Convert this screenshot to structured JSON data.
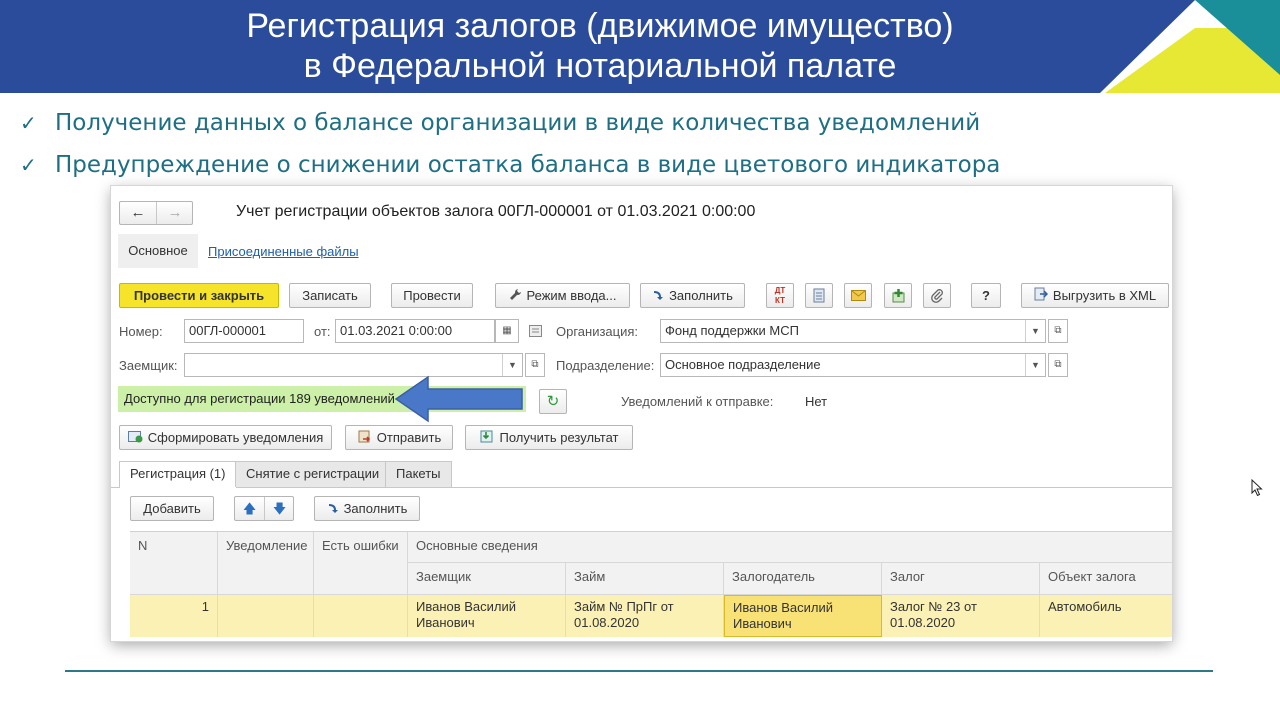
{
  "slide": {
    "title_line1": "Регистрация залогов (движимое имущество)",
    "title_line2": "в Федеральной нотариальной палате",
    "bullets": [
      "Получение данных о балансе организации в виде количества уведомлений",
      "Предупреждение о снижении остатка баланса в виде цветового индикатора"
    ]
  },
  "colors": {
    "header_bg": "#2b4c9b",
    "accent_yellow": "#f5e42a",
    "teal": "#1e6e84",
    "indicator_green": "#cdf0a8",
    "arrow_blue": "#4a78c8"
  },
  "window": {
    "title": "Учет регистрации объектов залога 00ГЛ-000001 от 01.03.2021 0:00:00",
    "nav_tabs": [
      "Основное",
      "Присоединенные файлы"
    ],
    "toolbar": {
      "post_close": "Провести и закрыть",
      "write": "Записать",
      "post": "Провести",
      "input_mode": "Режим ввода...",
      "fill": "Заполнить",
      "help": "?",
      "export_xml": "Выгрузить в XML",
      "icons": [
        "dt-kt-icon",
        "report-icon",
        "envelope-icon",
        "add-structure-icon",
        "paperclip-icon"
      ]
    },
    "form": {
      "number_label": "Номер:",
      "number_value": "00ГЛ-000001",
      "date_label": "от:",
      "date_value": "01.03.2021  0:00:00",
      "org_label": "Организация:",
      "org_value": "Фонд поддержки МСП",
      "borrower_label": "Заемщик:",
      "borrower_value": "",
      "dept_label": "Подразделение:",
      "dept_value": "Основное подразделение"
    },
    "balance": {
      "indicator_text": "Доступно для регистрации 189 уведомлений",
      "notices_to_send_label": "Уведомлений к отправке:",
      "notices_to_send_value": "Нет"
    },
    "actions": {
      "generate": "Сформировать уведомления",
      "send": "Отправить",
      "get_result": "Получить результат"
    },
    "tabs": [
      "Регистрация (1)",
      "Снятие с регистрации",
      "Пакеты"
    ],
    "table_toolbar": {
      "add": "Добавить",
      "fill": "Заполнить"
    },
    "table": {
      "headers_top": [
        "N",
        "Уведомление",
        "Есть ошибки",
        "Основные сведения"
      ],
      "headers_sub": [
        "Заемщик",
        "Займ",
        "Залогодатель",
        "Залог",
        "Объект залога"
      ],
      "rows": [
        {
          "n": "1",
          "notice": "",
          "errors": "",
          "borrower": "Иванов Василий Иванович",
          "loan": "Займ № ПрПг от 01.08.2020",
          "pledgor": "Иванов Василий Иванович",
          "pledge": "Залог № 23 от 01.08.2020",
          "object": "Автомобиль"
        }
      ]
    }
  }
}
